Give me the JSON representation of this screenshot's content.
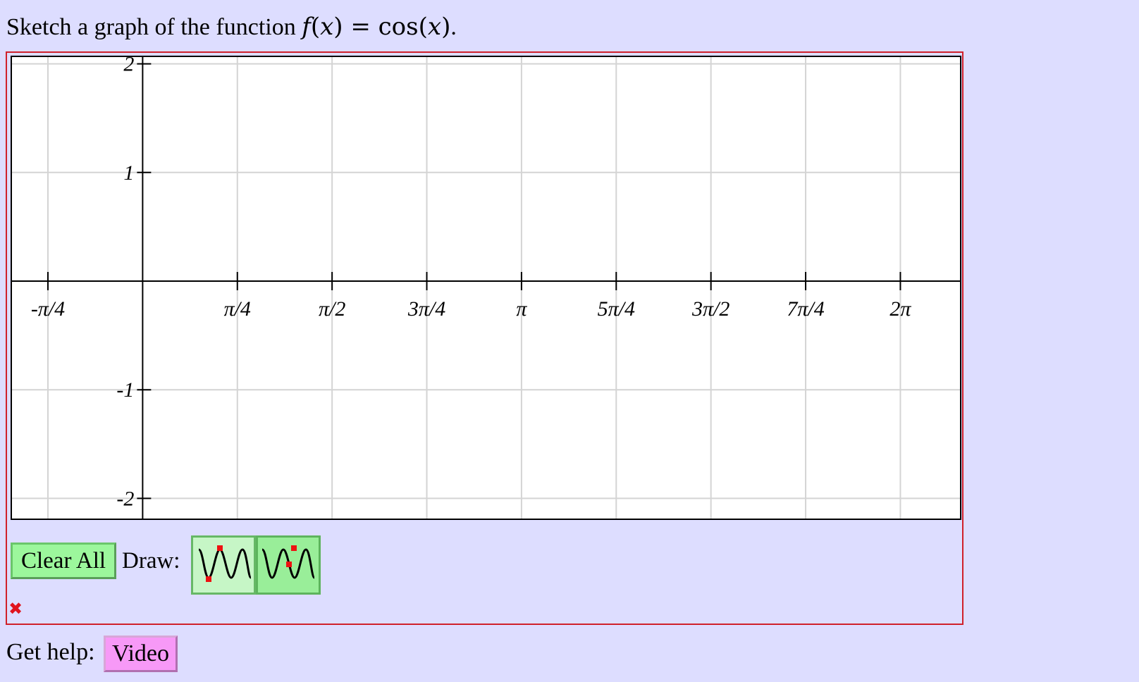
{
  "question": {
    "prefix": "Sketch a graph of the function ",
    "fx": "f",
    "paren_open": "(",
    "x_var": "x",
    "paren_close": ")",
    "equals": " = ",
    "cos": "cos",
    "cos_open": "(",
    "cos_x": "x",
    "cos_close": ")",
    "period": "."
  },
  "graph": {
    "xlim": [
      -0.7854,
      6.5
    ],
    "ylim": [
      -2,
      2
    ],
    "x_ticks": [
      {
        "value": -0.7854,
        "label": "-π/4"
      },
      {
        "value": 0.7854,
        "label": "π/4"
      },
      {
        "value": 1.5708,
        "label": "π/2"
      },
      {
        "value": 2.3562,
        "label": "3π/4"
      },
      {
        "value": 3.1416,
        "label": "π"
      },
      {
        "value": 3.927,
        "label": "5π/4"
      },
      {
        "value": 4.7124,
        "label": "3π/2"
      },
      {
        "value": 5.4978,
        "label": "7π/4"
      },
      {
        "value": 6.2832,
        "label": "2π"
      }
    ],
    "y_ticks": [
      {
        "value": 2,
        "label": "2"
      },
      {
        "value": 1,
        "label": "1"
      },
      {
        "value": -1,
        "label": "-1"
      },
      {
        "value": -2,
        "label": "-2"
      }
    ],
    "grid": true,
    "grid_color": "#d4d4d4",
    "axis_color": "#000000"
  },
  "controls": {
    "clear_label": "Clear All",
    "draw_label": "Draw:",
    "tools": [
      {
        "icon": "sine-wave-two-points-icon"
      },
      {
        "icon": "sine-wave-midline-point-icon"
      }
    ]
  },
  "status": {
    "error_icon": "✖",
    "error_color": "#e0141e"
  },
  "help": {
    "label": "Get help:",
    "video_label": "Video"
  },
  "colors": {
    "background": "#ddddff",
    "panel_border": "#d0202a",
    "clear_button": "#9cf79c",
    "video_button": "#f799f7"
  }
}
